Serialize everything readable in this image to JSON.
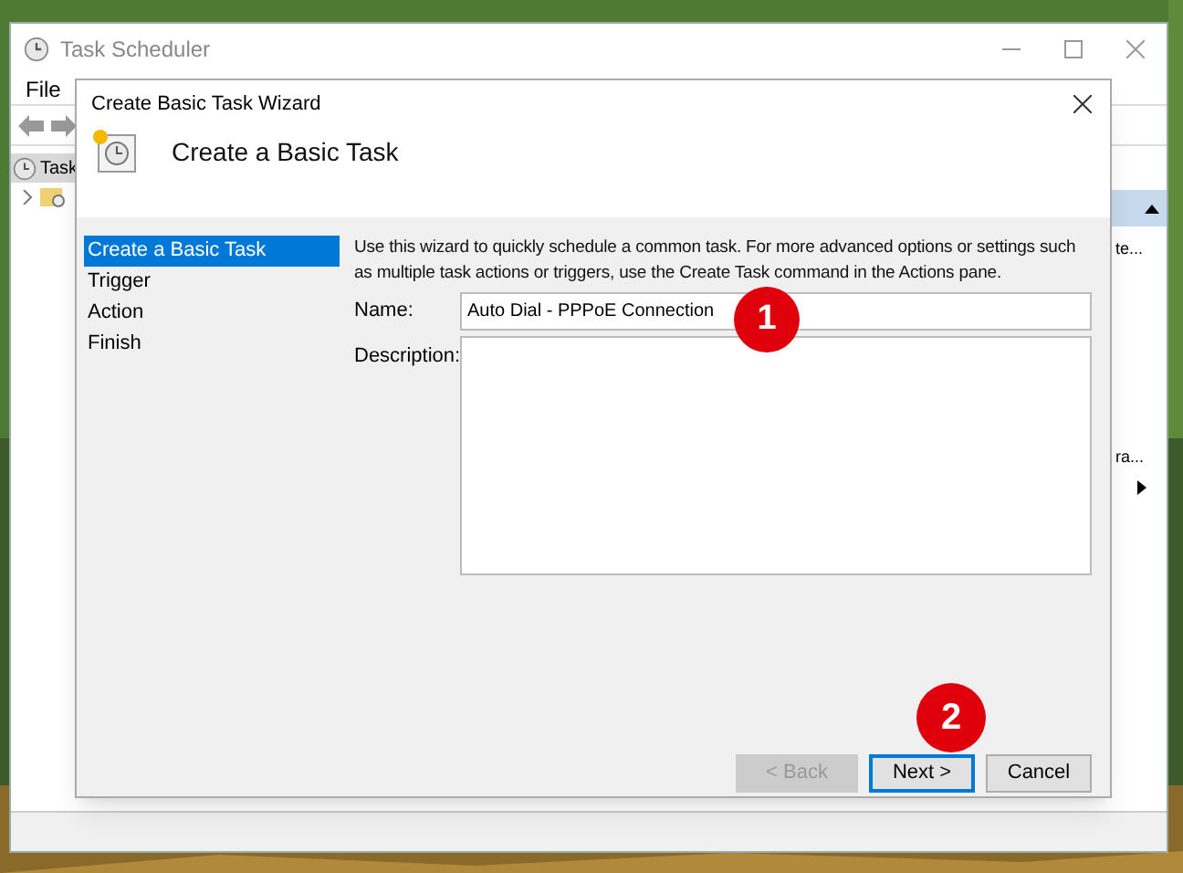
{
  "main_window": {
    "title": "Task Scheduler",
    "menu": [
      "File"
    ],
    "tree": [
      {
        "label": "Task",
        "selected": true
      }
    ],
    "actions_pane": {
      "texts": [
        "te...",
        "ra..."
      ]
    }
  },
  "dialog": {
    "title": "Create Basic Task Wizard",
    "heading": "Create a Basic Task",
    "steps": [
      {
        "label": "Create a Basic Task",
        "selected": true
      },
      {
        "label": "Trigger",
        "selected": false
      },
      {
        "label": "Action",
        "selected": false
      },
      {
        "label": "Finish",
        "selected": false
      }
    ],
    "intro": "Use this wizard to quickly schedule a common task.  For more advanced options or settings such as multiple task actions or triggers, use the Create Task command in the Actions pane.",
    "name_label": "Name:",
    "name_value": "Auto Dial - PPPoE Connection",
    "description_label": "Description:",
    "buttons": [
      {
        "label": "< Back",
        "disabled": true,
        "default": false
      },
      {
        "label": "Next >",
        "disabled": false,
        "default": true
      },
      {
        "label": "Cancel",
        "disabled": false,
        "default": false
      }
    ]
  },
  "annotations": [
    "1",
    "2"
  ]
}
